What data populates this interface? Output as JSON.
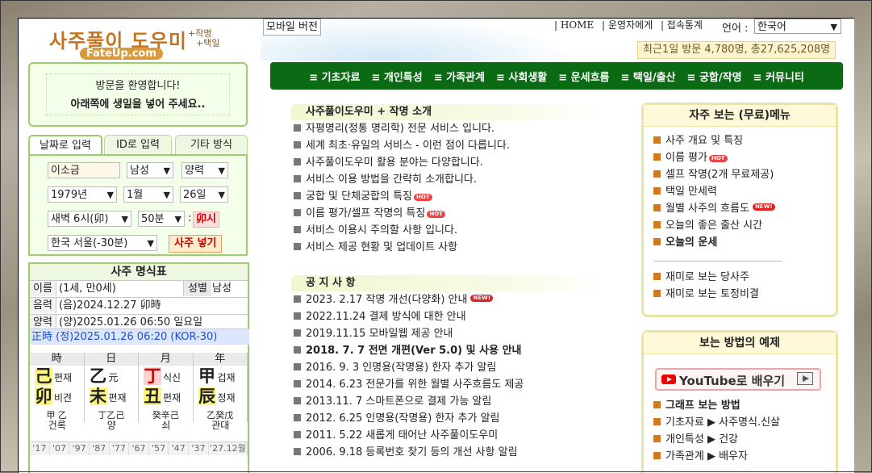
{
  "header": {
    "logo_title": "사주풀이 도우미",
    "logo_sub1": "+작명",
    "logo_sub2": "+택일",
    "logo_domain": "FateUp.com",
    "mobile_label": "모바일 버전",
    "top_links": [
      "| HOME",
      "| 운영자에게",
      "| 접속통계"
    ],
    "lang_label": "언어 :",
    "lang_value": "한국어",
    "visit_stats": "최근1일 방문 4,780명, 총27,625,208명"
  },
  "nav": [
    "≡ 기초자료",
    "≡ 개인특성",
    "≡ 가족관계",
    "≡ 사회생활",
    "≡ 운세흐름",
    "≡ 택일/출산",
    "≡ 궁합/작명",
    "≡ 커뮤니티"
  ],
  "welcome": {
    "line1": "방문을 환영합니다!",
    "line2": "아래쪽에 생일을 넣어 주세요.."
  },
  "input_tabs": [
    "날짜로 입력",
    "ID로 입력",
    "기타 방식"
  ],
  "form": {
    "name": "이소금",
    "gender": "남성",
    "calendar": "양력",
    "year": "1979년",
    "month": "1월",
    "day": "26일",
    "hour": "새벽 6시(卯)",
    "minute": "50분",
    "colon": ":",
    "hour_mark": "卯시",
    "region": "한국 서울(-30분)",
    "submit": "사주 넣기"
  },
  "myeongsik": {
    "title": "사주 명식표",
    "name_label": "이름",
    "name_value": "(1세, 만0세)",
    "gender_label": "성별",
    "gender_value": "남성",
    "lunar_label": "음력",
    "lunar_value": "(음)2024.12.27 卯時",
    "solar_label": "양력",
    "solar_value": "(양)2025.01.26 06:50 일요일",
    "jeongsi": "正時 (정)2025.01.26 06:20 (KOR-30)",
    "pillar_heads": [
      "時",
      "日",
      "月",
      "年"
    ],
    "pillars": [
      {
        "top": "己",
        "top_label": "편재",
        "bot": "卯",
        "bot_label": "비견",
        "jg": "甲 乙"
      },
      {
        "top": "乙",
        "top_label": "元",
        "bot": "未",
        "bot_label": "편재",
        "jg": "丁乙己"
      },
      {
        "top": "丁",
        "top_label": "식신",
        "bot": "丑",
        "bot_label": "편재",
        "jg": "癸辛己"
      },
      {
        "top": "甲",
        "top_label": "겁재",
        "bot": "辰",
        "bot_label": "정재",
        "jg": "乙癸戊"
      }
    ],
    "unsung": [
      "건록",
      "양",
      "쇠",
      "관대"
    ],
    "daeun": [
      "'17",
      "'07",
      "'97",
      "'87",
      "'77",
      "'67",
      "'57",
      "'47",
      "'37",
      "'27.12월"
    ]
  },
  "intro": {
    "title": "사주풀이도우미 + 작명 소개",
    "items": [
      "자평명리(정통 명리학) 전문 서비스 입니다.",
      "세계 최초·유일의 서비스 - 이런 점이 다릅니다.",
      "사주풀이도우미 활용 분야는 다양합니다.",
      "서비스 이용 방법을 간략히 소개합니다.",
      "궁합 및 단체궁합의 특징",
      "이름 평가/셀프 작명의 특징",
      "서비스 이용시 주의할 사항 입니다.",
      "서비스 제공 현황 및 업데이트 사항"
    ]
  },
  "notice": {
    "title": "공 지 사 항",
    "items": [
      "2023. 2.17 작명 개선(다양화) 안내",
      "2022.11.24 결제 방식에 대한 안내",
      "2019.11.15 모바일웹 제공 안내",
      "2018. 7. 7 전면 개편(Ver 5.0) 및 사용 안내",
      "2016. 9. 3 인명용(작명용) 한자 추가 알림",
      "2014. 6.23 전문가를 위한 월별 사주흐름도 제공",
      "2013.11. 7 스마트폰으로 결제 가능 알림",
      "2012. 6.25 인명용(작명용) 한자 추가 알림",
      "2011. 5.22 새롭게 태어난 사주풀이도우미",
      "2006. 9.18 등록번호 찾기 등의 개선 사항 알림"
    ]
  },
  "free_menu": {
    "title": "자주 보는 (무료)메뉴",
    "items": [
      "사주 개요 및 특징",
      "이름 평가",
      "셀프 작명(2개 무료제공)",
      "택일 만세력",
      "월별 사주의 흐름도",
      "오늘의 좋은 출산 시간",
      "오늘의 운세"
    ],
    "fun_items": [
      "재미로 보는 당사주",
      "재미로 보는 토정비결"
    ]
  },
  "examples": {
    "title": "보는 방법의 예제",
    "youtube_label": "YouTube로 배우기",
    "items": [
      "그래프 보는 방법",
      "기초자료 ▶ 사주명식.신살",
      "개인특성 ▶ 건강",
      "가족관계 ▶ 배우자"
    ]
  },
  "badges": {
    "hot": "HOT",
    "new": "NEW!"
  }
}
